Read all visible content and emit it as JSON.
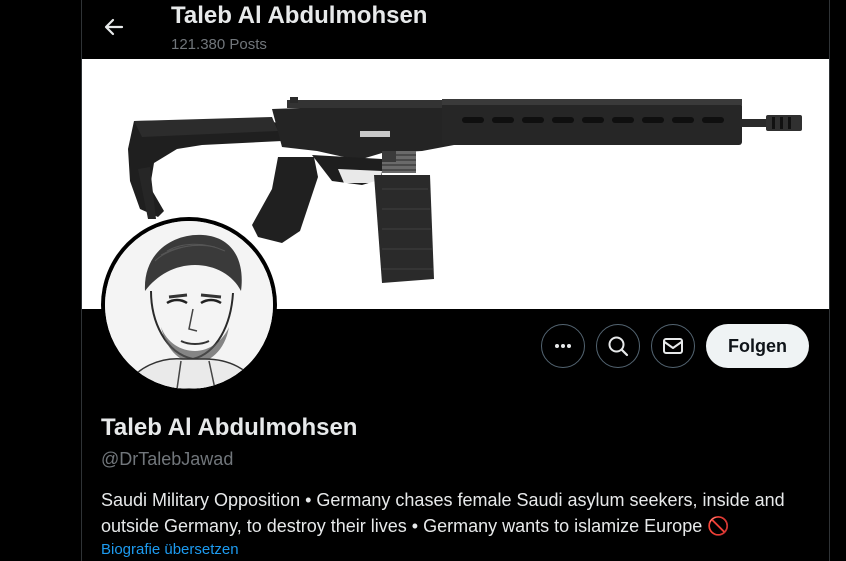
{
  "header": {
    "title": "Taleb Al Abdulmohsen",
    "post_count": "121.380 Posts",
    "back_icon": "arrow-left-icon"
  },
  "banner": {
    "subject": "rifle-image"
  },
  "profile": {
    "name": "Taleb Al Abdulmohsen",
    "handle": "@DrTalebJawad",
    "bio": "Saudi Military Opposition • Germany chases female Saudi asylum seekers, inside and outside Germany, to destroy their lives • Germany wants to islamize Europe",
    "bio_emoji": "🚫",
    "translate_link": "Biografie übersetzen"
  },
  "actions": {
    "more_icon": "more-horizontal-icon",
    "search_icon": "search-icon",
    "message_icon": "mail-icon",
    "follow_label": "Folgen"
  },
  "colors": {
    "background": "#000000",
    "primary_text": "#e7e9ea",
    "secondary_text": "#71767b",
    "link": "#1d9bf0",
    "follow_bg": "#eff3f4"
  }
}
